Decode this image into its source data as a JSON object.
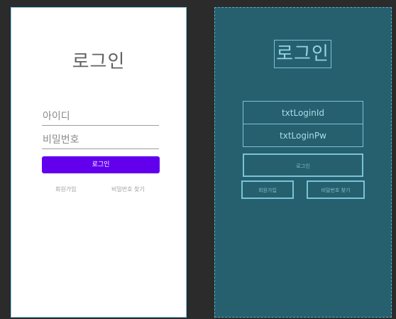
{
  "design": {
    "title": "로그인",
    "id_hint": "아이디",
    "pw_hint": "비밀번호",
    "login_button": "로그인",
    "signup_link": "회원가입",
    "find_pw_link": "비밀번호 찾기"
  },
  "blueprint": {
    "title": "로그인",
    "id_field": "txtLoginId",
    "pw_field": "txtLoginPw",
    "login_button": "로그인",
    "signup_button": "회원가입",
    "find_pw_button": "비밀번호 찾기"
  },
  "colors": {
    "editor_background": "#2b2b2b",
    "blueprint_background": "#265f6e",
    "primary_button": "#6200ee"
  }
}
